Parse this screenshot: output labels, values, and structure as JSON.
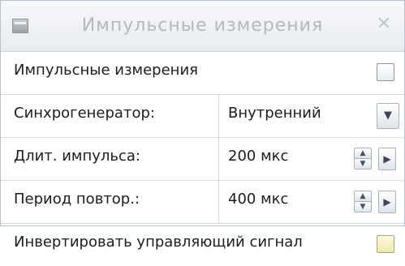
{
  "window": {
    "title": "Импульсные измерения",
    "icon": "panel-icon",
    "close_glyph": "✕"
  },
  "rows": [
    {
      "label": "Импульсные измерения",
      "control": "checkbox",
      "checked": false
    },
    {
      "label": "Синхрогенератор:",
      "control": "dropdown",
      "value": "Внутренний"
    },
    {
      "label": "Длит. импульса:",
      "control": "spinner",
      "value": "200 мкс"
    },
    {
      "label": "Период повтор.:",
      "control": "spinner",
      "value": "400 мкс"
    },
    {
      "label": "Инвертировать управляющий сигнал",
      "control": "checkbox",
      "checked": false
    }
  ],
  "glyphs": {
    "dropdown": "▼",
    "spin_up": "▲",
    "spin_down": "▼",
    "step_right": "▶"
  },
  "colors": {
    "border": "#b8c3cf",
    "title_text": "#b5b8bd",
    "label_text": "#1d1d1d",
    "yellow_checkbox": "#efe6a8"
  }
}
